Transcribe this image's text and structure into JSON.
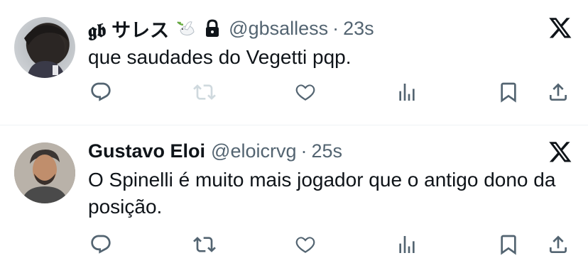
{
  "tweets": [
    {
      "name": "𝖌𝖇 サレス",
      "handle": "@gbsalless",
      "separator": "·",
      "time": "23s",
      "text": "que saudades do Vegetti pqp.",
      "badges": [
        "dove-emoji-icon",
        "lock-icon"
      ],
      "retweet_enabled": false
    },
    {
      "name": "Gustavo Eloi",
      "handle": "@eloicrvg",
      "separator": "·",
      "time": "25s",
      "text": "O Spinelli é muito mais jogador que o antigo dono da posição.",
      "badges": [],
      "retweet_enabled": true
    }
  ],
  "colors": {
    "icon": "#536471",
    "icon_disabled": "#cfd9de",
    "text": "#0f1419",
    "secondary": "#536471",
    "divider": "#eff3f4"
  }
}
